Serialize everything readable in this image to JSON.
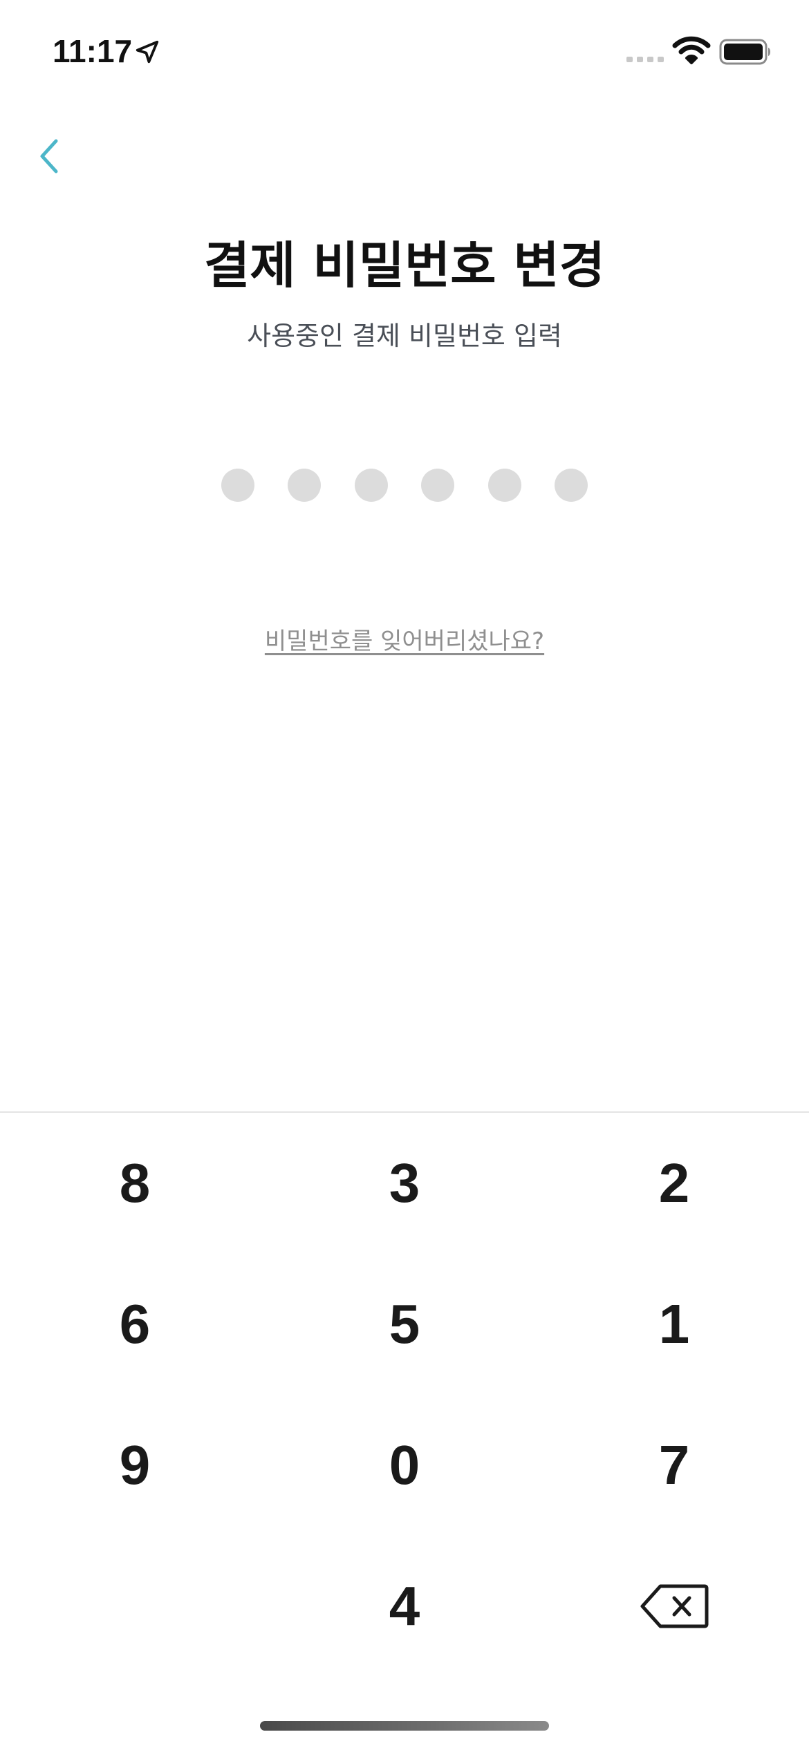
{
  "status_bar": {
    "time": "11:17"
  },
  "header": {
    "back_icon": "chevron-left-icon",
    "accent_color": "#4cb6c9"
  },
  "title": "결제 비밀번호 변경",
  "subtitle": "사용중인 결제 비밀번호 입력",
  "pin": {
    "length": 6,
    "entered": 0
  },
  "forgot_password": "비밀번호를 잊어버리셨나요?",
  "keypad": {
    "rows": [
      [
        "8",
        "3",
        "2"
      ],
      [
        "6",
        "5",
        "1"
      ],
      [
        "9",
        "0",
        "7"
      ],
      [
        "",
        "4",
        "backspace"
      ]
    ],
    "backspace_icon": "backspace-icon"
  }
}
